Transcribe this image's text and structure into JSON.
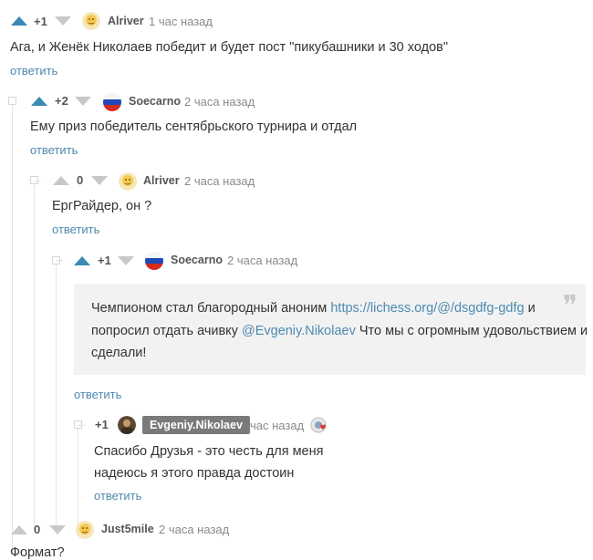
{
  "comments": [
    {
      "score": "+1",
      "user": "Alriver",
      "time": "1 час назад",
      "text": "Ага, и Женёк Николаев победит и будет пост \"пикубашники и 30 ходов\"",
      "reply": "ответить"
    },
    {
      "score": "+2",
      "user": "Soecarno",
      "time": "2 часа назад",
      "text": "Ему приз победитель сентябрьского турнира и отдал",
      "reply": "ответить"
    },
    {
      "score": "0",
      "user": "Alriver",
      "time": "2 часа назад",
      "text": "ЕргРайдер, он ?",
      "reply": "ответить"
    },
    {
      "score": "+1",
      "user": "Soecarno",
      "time": "2 часа назад",
      "quote_part1": "Чемпионом стал благородный аноним ",
      "quote_link": "https://lichess.org/@/dsgdfg-gdfg",
      "quote_part2": " и",
      "quote_part3": "попросил отдать ачивку ",
      "quote_mention": "@Evgeniy.Nikolaev",
      "quote_part4": " Что мы с огромным удовольствием и",
      "quote_part5": "сделали!",
      "reply": "ответить"
    },
    {
      "score": "+1",
      "user": "Evgeniy.Nikolaev",
      "time": "час назад",
      "text_line1": "Спасибо Друзья - это честь для меня",
      "text_line2": "надеюсь я этого правда достоин",
      "reply": "ответить"
    },
    {
      "score": "0",
      "user": "Just5mile",
      "time": "2 часа назад",
      "text": "Формат?"
    }
  ],
  "colors": {
    "upvote_active": "#3a8ab5",
    "vote_inactive": "#c8c8c8",
    "reply_link": "#4d8ab0"
  }
}
